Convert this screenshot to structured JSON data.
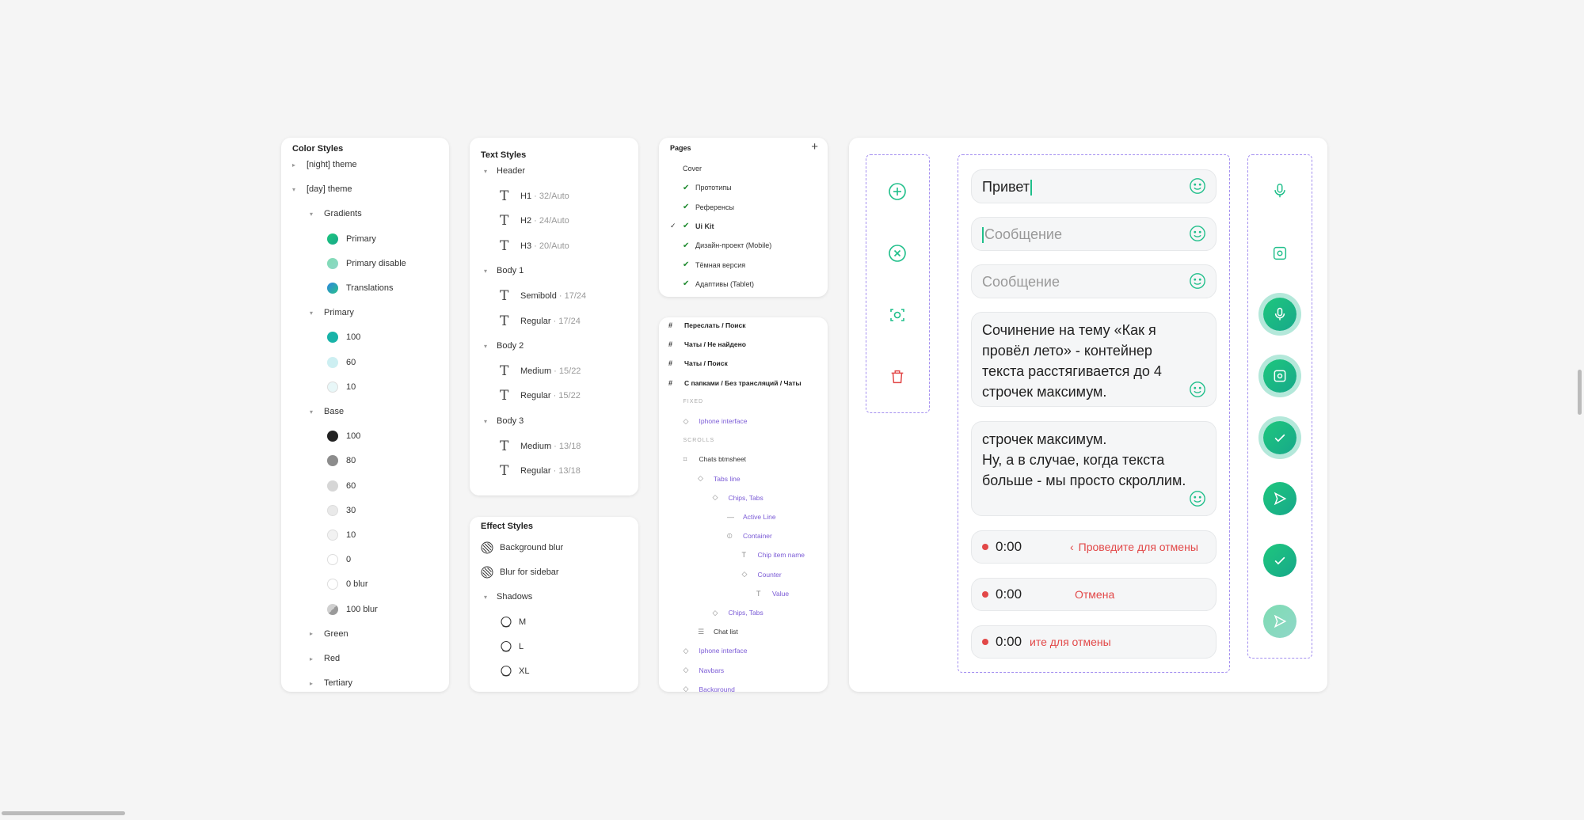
{
  "color_styles": {
    "title": "Color Styles",
    "rows": [
      {
        "label": "[night] theme",
        "indent": 0,
        "caret": "▸"
      },
      {
        "label": "[day] theme",
        "indent": 0,
        "caret": "▾"
      },
      {
        "label": "Gradients",
        "indent": 1,
        "caret": "▾"
      },
      {
        "label": "Primary",
        "indent": 2,
        "swatch": "linear-gradient(135deg,#1ec77d,#17a88a)"
      },
      {
        "label": "Primary disable",
        "indent": 2,
        "swatch": "linear-gradient(135deg,#7fdcb3,#8fd7c8)"
      },
      {
        "label": "Translations",
        "indent": 2,
        "swatch": "linear-gradient(135deg,#2f86e0,#27c08a)"
      },
      {
        "label": "Primary",
        "indent": 1,
        "caret": "▾"
      },
      {
        "label": "100",
        "indent": 2,
        "swatch": "#18b3a8"
      },
      {
        "label": "60",
        "indent": 2,
        "swatch": "#cdeff2"
      },
      {
        "label": "10",
        "indent": 2,
        "swatch": "#e8f7f8"
      },
      {
        "label": "Base",
        "indent": 1,
        "caret": "▾"
      },
      {
        "label": "100",
        "indent": 2,
        "swatch": "#222222"
      },
      {
        "label": "80",
        "indent": 2,
        "swatch": "#8c8c8c"
      },
      {
        "label": "60",
        "indent": 2,
        "swatch": "#d6d6d6"
      },
      {
        "label": "30",
        "indent": 2,
        "swatch": "#e9e9e9"
      },
      {
        "label": "10",
        "indent": 2,
        "swatch": "#f2f2f2"
      },
      {
        "label": "0",
        "indent": 2,
        "swatch": "#ffffff"
      },
      {
        "label": "0 blur",
        "indent": 2,
        "swatch": "#ffffff"
      },
      {
        "label": "100 blur",
        "indent": 2,
        "swatch": "linear-gradient(135deg,#d0d0d0 50%,#9a9a9a 50%)"
      },
      {
        "label": "Green",
        "indent": 1,
        "caret": "▸"
      },
      {
        "label": "Red",
        "indent": 1,
        "caret": "▸"
      },
      {
        "label": "Tertiary",
        "indent": 1,
        "caret": "▸"
      }
    ]
  },
  "text_styles": {
    "title": "Text Styles",
    "rows": [
      {
        "type": "group",
        "label": "Header"
      },
      {
        "type": "style",
        "label": "H1",
        "spec": " · 32/Auto"
      },
      {
        "type": "style",
        "label": "H2",
        "spec": " · 24/Auto"
      },
      {
        "type": "style",
        "label": "H3",
        "spec": " · 20/Auto"
      },
      {
        "type": "group",
        "label": "Body 1"
      },
      {
        "type": "style",
        "label": "Semibold",
        "spec": " · 17/24"
      },
      {
        "type": "style",
        "label": "Regular",
        "spec": " · 17/24"
      },
      {
        "type": "group",
        "label": "Body 2"
      },
      {
        "type": "style",
        "label": "Medium",
        "spec": " · 15/22"
      },
      {
        "type": "style",
        "label": "Regular",
        "spec": " · 15/22"
      },
      {
        "type": "group",
        "label": "Body 3"
      },
      {
        "type": "style",
        "label": "Medium",
        "spec": " · 13/18"
      },
      {
        "type": "style",
        "label": "Regular",
        "spec": " · 13/18"
      }
    ]
  },
  "effect_styles": {
    "title": "Effect Styles",
    "rows": [
      {
        "type": "blur",
        "label": "Background blur"
      },
      {
        "type": "blur",
        "label": "Blur for sidebar"
      },
      {
        "type": "group",
        "label": "Shadows"
      },
      {
        "type": "shadow",
        "label": "M"
      },
      {
        "type": "shadow",
        "label": "L"
      },
      {
        "type": "shadow",
        "label": "XL"
      }
    ]
  },
  "pages": {
    "title": "Pages",
    "add": "+",
    "items": [
      {
        "label": "Cover",
        "check": false,
        "current": false
      },
      {
        "label": "Прототипы",
        "check": true,
        "current": false
      },
      {
        "label": "Референсы",
        "check": true,
        "current": false
      },
      {
        "label": "Ui Kit",
        "check": true,
        "current": true
      },
      {
        "label": "Дизайн-проект (Mobile)",
        "check": true,
        "current": false
      },
      {
        "label": "Тёмная версия",
        "check": true,
        "current": false
      },
      {
        "label": "Адаптивы (Tablet)",
        "check": true,
        "current": false
      }
    ]
  },
  "layers": {
    "items": [
      {
        "label": "Переслать / Поиск",
        "kind": "bold",
        "icon": "#",
        "indent": 0
      },
      {
        "label": "Чаты / Не найдено",
        "kind": "bold",
        "icon": "#",
        "indent": 0
      },
      {
        "label": "Чаты / Поиск",
        "kind": "bold",
        "icon": "#",
        "indent": 0
      },
      {
        "label": "С папками / Без трансляций / Чаты",
        "kind": "bold",
        "icon": "#",
        "indent": 0
      },
      {
        "label": "FIXED",
        "kind": "sec",
        "icon": "",
        "indent": 1
      },
      {
        "label": "Iphone interface",
        "kind": "purple",
        "icon": "◇",
        "indent": 1
      },
      {
        "label": "SCROLLS",
        "kind": "sec",
        "icon": "",
        "indent": 1
      },
      {
        "label": "Chats btmsheet",
        "kind": "gray",
        "icon": "⌗",
        "indent": 1
      },
      {
        "label": "Tabs line",
        "kind": "purple",
        "icon": "◇",
        "indent": 2
      },
      {
        "label": "Chips, Tabs",
        "kind": "purple",
        "icon": "◇",
        "indent": 3
      },
      {
        "label": "Active Line",
        "kind": "purple",
        "icon": "—",
        "indent": 4
      },
      {
        "label": "Container",
        "kind": "purple",
        "icon": "⦶",
        "indent": 4
      },
      {
        "label": "Chip item name",
        "kind": "purple",
        "icon": "T",
        "indent": 5
      },
      {
        "label": "Counter",
        "kind": "purple",
        "icon": "◇",
        "indent": 5
      },
      {
        "label": "Value",
        "kind": "purple",
        "icon": "T",
        "indent": 6
      },
      {
        "label": "Chips, Tabs",
        "kind": "purple",
        "icon": "◇",
        "indent": 3
      },
      {
        "label": "Chat list",
        "kind": "gray",
        "icon": "☰",
        "indent": 2
      },
      {
        "label": "Iphone interface",
        "kind": "purple",
        "icon": "◇",
        "indent": 1
      },
      {
        "label": "Navbars",
        "kind": "purple",
        "icon": "◇",
        "indent": 1
      },
      {
        "label": "Background",
        "kind": "purple",
        "icon": "◇",
        "indent": 1
      }
    ]
  },
  "inputs": {
    "field1_text": "Привет",
    "field2_placeholder": "Сообщение",
    "field3_placeholder": "Сообщение",
    "long_text": "Сочинение на тему «Как я провёл лето» - контейнер текста расстягивается до 4 строчек максимум.",
    "scroll_text": "строчек максимум.\nНу, а в случае, когда текста больше - мы просто скроллим.",
    "rec1": {
      "time": "0:00",
      "hint": "Проведите для отмены"
    },
    "rec2": {
      "time": "0:00",
      "hint": "Отмена"
    },
    "rec3": {
      "time": "0:00",
      "hint": "ите для отмены"
    }
  },
  "colors": {
    "accent": "#1fbf8a",
    "danger": "#e24848",
    "dash": "#a48ff0",
    "purple_text": "#7b5bd6"
  }
}
